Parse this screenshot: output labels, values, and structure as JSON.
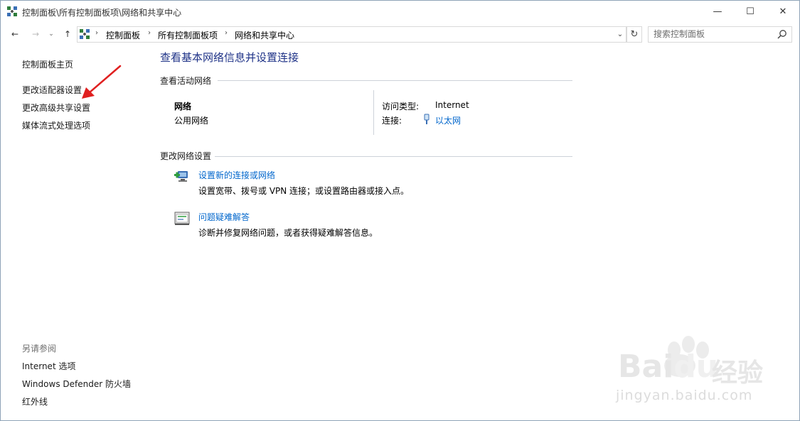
{
  "window": {
    "title": "控制面板\\所有控制面板项\\网络和共享中心",
    "minimize": "—",
    "maximize": "☐",
    "close": "✕"
  },
  "nav": {
    "back": "←",
    "forward": "→",
    "history": "⌄",
    "up": "↑",
    "refresh": "↻",
    "dropdown": "⌄"
  },
  "breadcrumb": [
    "控制面板",
    "所有控制面板项",
    "网络和共享中心"
  ],
  "breadcrumb_sep": "›",
  "search": {
    "placeholder": "搜索控制面板"
  },
  "left_pane": {
    "home": "控制面板主页",
    "items": [
      "更改适配器设置",
      "更改高级共享设置",
      "媒体流式处理选项"
    ],
    "see_also_header": "另请参阅",
    "see_also": [
      "Internet 选项",
      "Windows Defender 防火墙",
      "红外线"
    ]
  },
  "main": {
    "title": "查看基本网络信息并设置连接",
    "active_section": "查看活动网络",
    "network": {
      "name": "网络",
      "type": "公用网络",
      "access_label": "访问类型:",
      "access_value": "Internet",
      "connection_label": "连接:",
      "connection_value": "以太网"
    },
    "change_section": "更改网络设置",
    "tasks": [
      {
        "link": "设置新的连接或网络",
        "desc": "设置宽带、拨号或 VPN 连接；或设置路由器或接入点。"
      },
      {
        "link": "问题疑难解答",
        "desc": "诊断并修复网络问题，或者获得疑难解答信息。"
      }
    ]
  },
  "watermark": {
    "brand": "Bai",
    "brand2": "du",
    "label": "经验",
    "url": "jingyan.baidu.com"
  },
  "colors": {
    "link": "#0066cc",
    "title": "#1e3287",
    "annotation_arrow": "#e02020"
  }
}
